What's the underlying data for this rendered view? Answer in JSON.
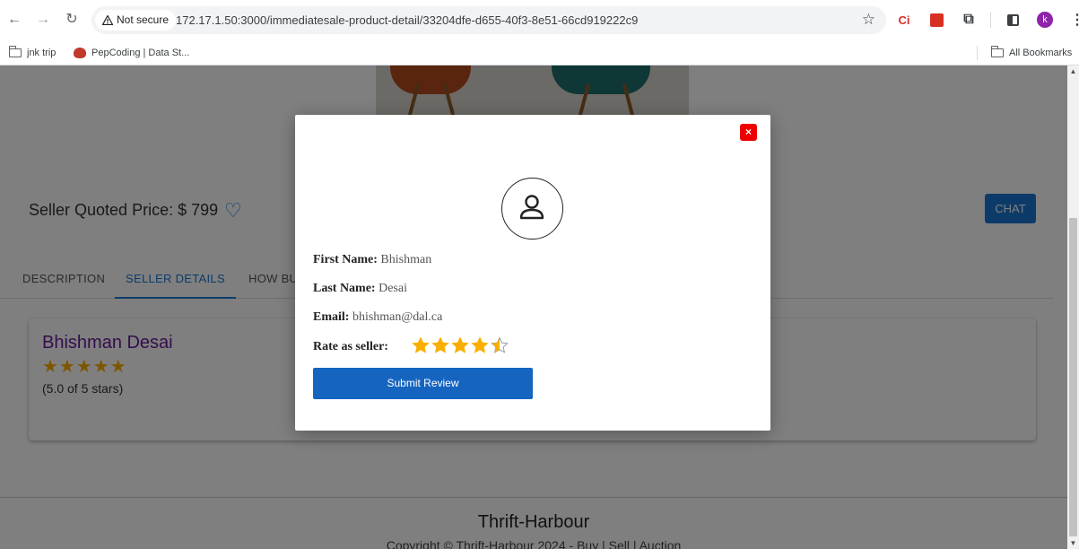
{
  "browser": {
    "nav": {
      "back": "←",
      "forward": "→",
      "reload": "↻"
    },
    "security_label": "Not secure",
    "url": "172.17.1.50:3000/immediatesale-product-detail/33204dfe-d655-40f3-8e51-66cd919222c9",
    "extensions": {
      "ci_label": "Ci",
      "profile_initial": "k"
    },
    "bookmarks": [
      {
        "label": "jnk trip",
        "icon": "folder-icon"
      },
      {
        "label": "PepCoding | Data St...",
        "icon": "pepcoding-icon"
      }
    ],
    "all_bookmarks_label": "All Bookmarks"
  },
  "product": {
    "price_label": "Seller Quoted Price: $ 799",
    "chat_label": "CHAT"
  },
  "tabs": [
    {
      "label": "DESCRIPTION",
      "active": false
    },
    {
      "label": "SELLER DETAILS",
      "active": true
    },
    {
      "label": "HOW BU",
      "active": false
    }
  ],
  "seller_card": {
    "name": "Bhishman Desai",
    "stars": "★★★★★",
    "rating_text": "(5.0 of 5 stars)"
  },
  "footer": {
    "brand": "Thrift-Harbour",
    "copyright": "Copyright © Thrift-Harbour 2024 - Buy | Sell | Auction"
  },
  "modal": {
    "close_glyph": "×",
    "first_name_label": "First Name:",
    "first_name": "Bhishman",
    "last_name_label": "Last Name:",
    "last_name": "Desai",
    "email_label": "Email:",
    "email": "bhishman@dal.ca",
    "rate_label": "Rate as seller:",
    "rating_value": 4.5,
    "rating_max": 5,
    "submit_label": "Submit Review"
  },
  "colors": {
    "accent": "#1976d2",
    "submit": "#1565c0",
    "star": "#faaf00",
    "seller_name": "#6a1b9a",
    "close": "#ee0000"
  }
}
